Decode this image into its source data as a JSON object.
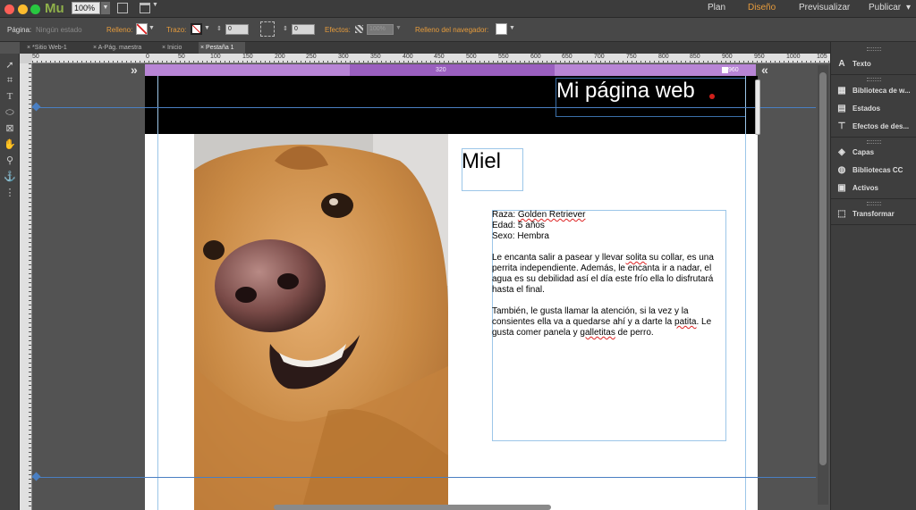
{
  "app": {
    "name": "Mu",
    "zoom": "100%",
    "nav": [
      "Plan",
      "Diseño",
      "Previsualizar",
      "Publicar"
    ],
    "active_nav": "Diseño",
    "publish_arrow": "▾"
  },
  "options": {
    "page_label": "Página:",
    "page_state": "Ningún estado",
    "fill_label": "Relleno:",
    "stroke_label": "Trazo:",
    "stroke_value": "0",
    "corner_value": "0",
    "effects_label": "Efectos:",
    "effects_value": "100%",
    "browser_fill_label": "Relleno del navegador:"
  },
  "tabs": [
    {
      "label": "*Sitio Web-1"
    },
    {
      "label": "A-Pág. maestra"
    },
    {
      "label": "Inicio"
    },
    {
      "label": "Pestaña 1"
    }
  ],
  "tab_close": "×",
  "ruler_ticks": [
    "0",
    "50",
    "100",
    "150",
    "200",
    "250",
    "300",
    "350",
    "400",
    "450",
    "500",
    "550",
    "600",
    "650",
    "700",
    "750",
    "800",
    "850",
    "900",
    "950",
    "1000",
    "105"
  ],
  "ruler_left_neg": [
    "50",
    "0"
  ],
  "breakpoint": {
    "left_value": "320",
    "right_value": "960",
    "left_arrows": "»",
    "right_arrows": "«"
  },
  "page": {
    "site_title": "Mi página web",
    "dog_name": "Miel",
    "lines": [
      {
        "pre": "Raza: ",
        "squig": "Golden Retriever",
        "post": ""
      },
      {
        "pre": "Edad: 5 años",
        "squig": "",
        "post": ""
      },
      {
        "pre": "Sexo: Hembra",
        "squig": "",
        "post": ""
      }
    ],
    "para1": {
      "a": "Le encanta salir a pasear y llevar ",
      "b": "solita",
      "c": " su collar, es una perrita independiente. Además, le encanta ir a nadar, el agua es su debilidad así el día este frío ella lo disfrutará hasta el final."
    },
    "para2": {
      "a": "También, le gusta llamar la atención, si la vez y la consientes ella va a quedarse ahí y a darte la ",
      "b": "patita",
      "c": ". Le gusta comer panela y ",
      "d": "galletitas",
      "e": " de perro."
    }
  },
  "panels": [
    {
      "label": "Texto",
      "icon": "A"
    },
    {
      "label": "Biblioteca de w...",
      "icon": "▦"
    },
    {
      "label": "Estados",
      "icon": "▤"
    },
    {
      "label": "Efectos de des...",
      "icon": "⊤"
    },
    {
      "label": "Capas",
      "icon": "◈"
    },
    {
      "label": "Bibliotecas CC",
      "icon": "◍"
    },
    {
      "label": "Activos",
      "icon": "▣"
    },
    {
      "label": "Transformar",
      "icon": "⬚"
    }
  ],
  "colors": {
    "breakpoint": "#b885d6",
    "accent_nav": "#e59b3c",
    "title_dot": "#d0201b"
  }
}
